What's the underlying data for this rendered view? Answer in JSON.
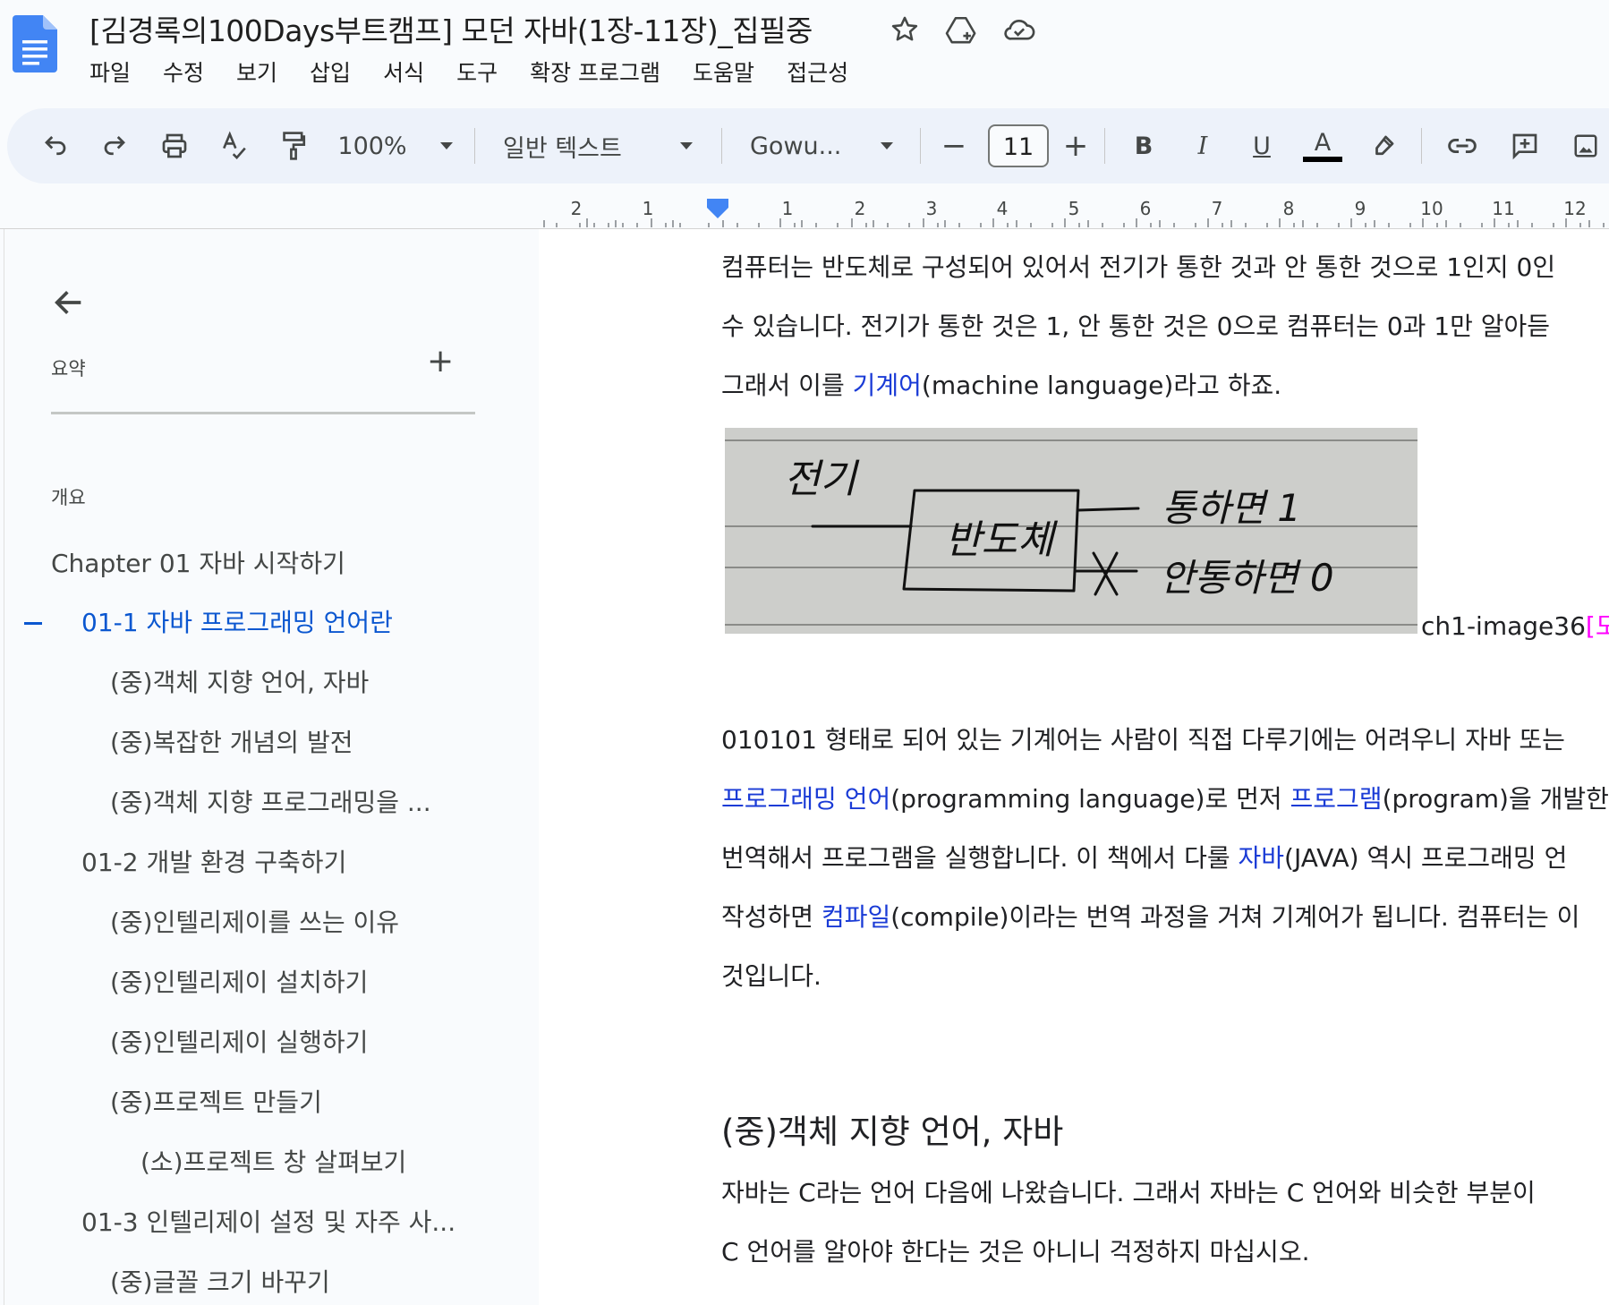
{
  "header": {
    "title": "[김경록의100Days부트캠프] 모던 자바(1장-11장)_집필중",
    "icons": [
      "star-icon",
      "move-to-drive-icon",
      "cloud-status-icon"
    ]
  },
  "menu": [
    "파일",
    "수정",
    "보기",
    "삽입",
    "서식",
    "도구",
    "확장 프로그램",
    "도움말",
    "접근성"
  ],
  "toolbar": {
    "zoom": "100%",
    "style": "일반 텍스트",
    "font": "Gowu...",
    "font_size": "11",
    "minus": "−",
    "plus": "+",
    "bold": "B",
    "italic": "I",
    "underline": "U",
    "text_color": "A",
    "colors": {
      "text_color_bar": "#000000",
      "accent": "#0b57d0"
    }
  },
  "ruler": {
    "left_numbers": [
      "2",
      "1"
    ],
    "right_numbers": [
      "1",
      "2",
      "3",
      "4",
      "5",
      "6",
      "7",
      "8",
      "9",
      "10",
      "11",
      "12"
    ]
  },
  "sidebar": {
    "summary_label": "요약",
    "add": "+",
    "outline_label": "개요",
    "items": [
      {
        "label": "Chapter 01 자바 시작하기"
      },
      {
        "label": "01-1 자바 프로그래밍 언어란"
      },
      {
        "label": "(중)객체 지향 언어, 자바"
      },
      {
        "label": "(중)복잡한 개념의 발전"
      },
      {
        "label": "(중)객체 지향 프로그래밍을 ..."
      },
      {
        "label": "01-2 개발 환경 구축하기"
      },
      {
        "label": "(중)인텔리제이를 쓰는 이유"
      },
      {
        "label": "(중)인텔리제이 설치하기"
      },
      {
        "label": "(중)인텔리제이 실행하기"
      },
      {
        "label": "(중)프로젝트 만들기"
      },
      {
        "label": "(소)프로젝트 창 살펴보기"
      },
      {
        "label": "01-3 인텔리제이 설정 및 자주 사..."
      },
      {
        "label": "(중)글꼴 크기 바꾸기"
      }
    ]
  },
  "document": {
    "p1_line1": "컴퓨터는 반도체로 구성되어 있어서 전기가 통한 것과 안 통한 것으로 1인지 0인",
    "p1_line2": "수 있습니다. 전기가 통한 것은 1, 안 통한 것은 0으로 컴퓨터는 0과 1만 알아듣",
    "p1_line3_a": "그래서 이를 ",
    "p1_line3_kw": "기계어",
    "p1_line3_b": "(machine language)라고 하죠.",
    "sketch": {
      "left": "전기",
      "box": "반도체",
      "top_right": "통하면 1",
      "bottom_right": "안통하면 0"
    },
    "caption": "ch1-image36",
    "caption_tag": "[도식",
    "p2_line1": "010101 형태로 되어 있는 기계어는 사람이 직접 다루기에는 어려우니 자바 또는",
    "p2_line2_kw1": "프로그래밍 언어",
    "p2_line2_a": "(programming language)로 먼저 ",
    "p2_line2_kw2": "프로그램",
    "p2_line2_b": "(program)을 개발한",
    "p2_line3_a": "번역해서 프로그램을 실행합니다. 이 책에서 다룰 ",
    "p2_line3_kw": "자바",
    "p2_line3_b": "(JAVA) 역시 프로그래밍 언",
    "p2_line4_a": "작성하면 ",
    "p2_line4_kw": "컴파일",
    "p2_line4_b": "(compile)이라는 번역 과정을 거쳐 기계어가 됩니다. 컴퓨터는 이",
    "p2_line5": "것입니다.",
    "heading": "(중)객체 지향 언어, 자바",
    "p3_line1": "자바는 C라는 언어 다음에 나왔습니다. 그래서 자바는 C 언어와 비슷한 부분이",
    "p3_line2": "C 언어를 알아야 한다는 것은 아니니 걱정하지 마십시오."
  }
}
